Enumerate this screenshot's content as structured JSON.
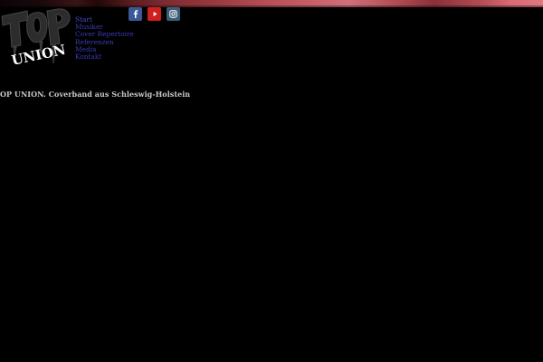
{
  "site": {
    "logo_text": "TOP UNION",
    "logo_word_top": "TOP",
    "logo_word_bottom": "UNION"
  },
  "nav": {
    "items": [
      {
        "label": "Start"
      },
      {
        "label": "Musiker"
      },
      {
        "label": "Cover Repertoire"
      },
      {
        "label": "Referenzen"
      },
      {
        "label": "Media"
      },
      {
        "label": "Kontakt"
      }
    ]
  },
  "social": {
    "icons": [
      "facebook-icon",
      "youtube-icon",
      "instagram-icon"
    ],
    "colors": {
      "facebook": "#3b5998",
      "youtube": "#d0201e",
      "instagram": "#3b5e78"
    }
  },
  "tagline": "TOP UNION. Coverband aus Schleswig-Holstein",
  "colors": {
    "background": "#000000",
    "nav_link": "#3a3ab8",
    "tagline": "#c8c8c8"
  }
}
